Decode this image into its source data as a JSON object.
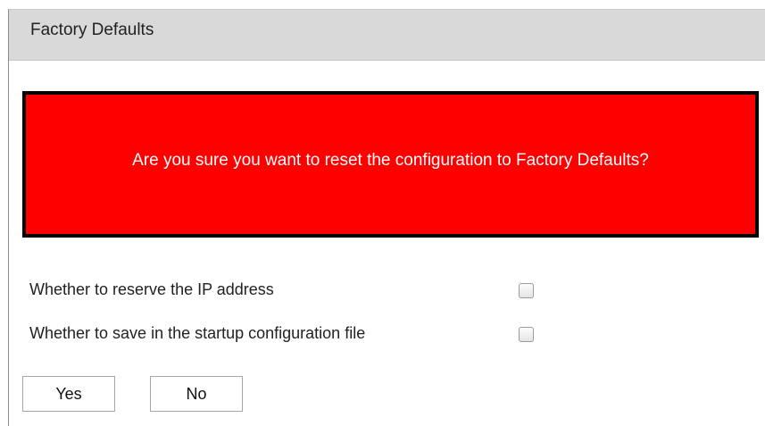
{
  "header": {
    "title": "Factory Defaults"
  },
  "alert": {
    "message": "Are you sure you want to reset the configuration to Factory Defaults?",
    "background_color": "#ff0000",
    "border_color": "#000000",
    "text_color": "#ffffff"
  },
  "options": [
    {
      "label": "Whether to reserve the IP address",
      "checked": false
    },
    {
      "label": "Whether to save in the startup configuration file",
      "checked": false
    }
  ],
  "buttons": {
    "yes_label": "Yes",
    "no_label": "No"
  }
}
